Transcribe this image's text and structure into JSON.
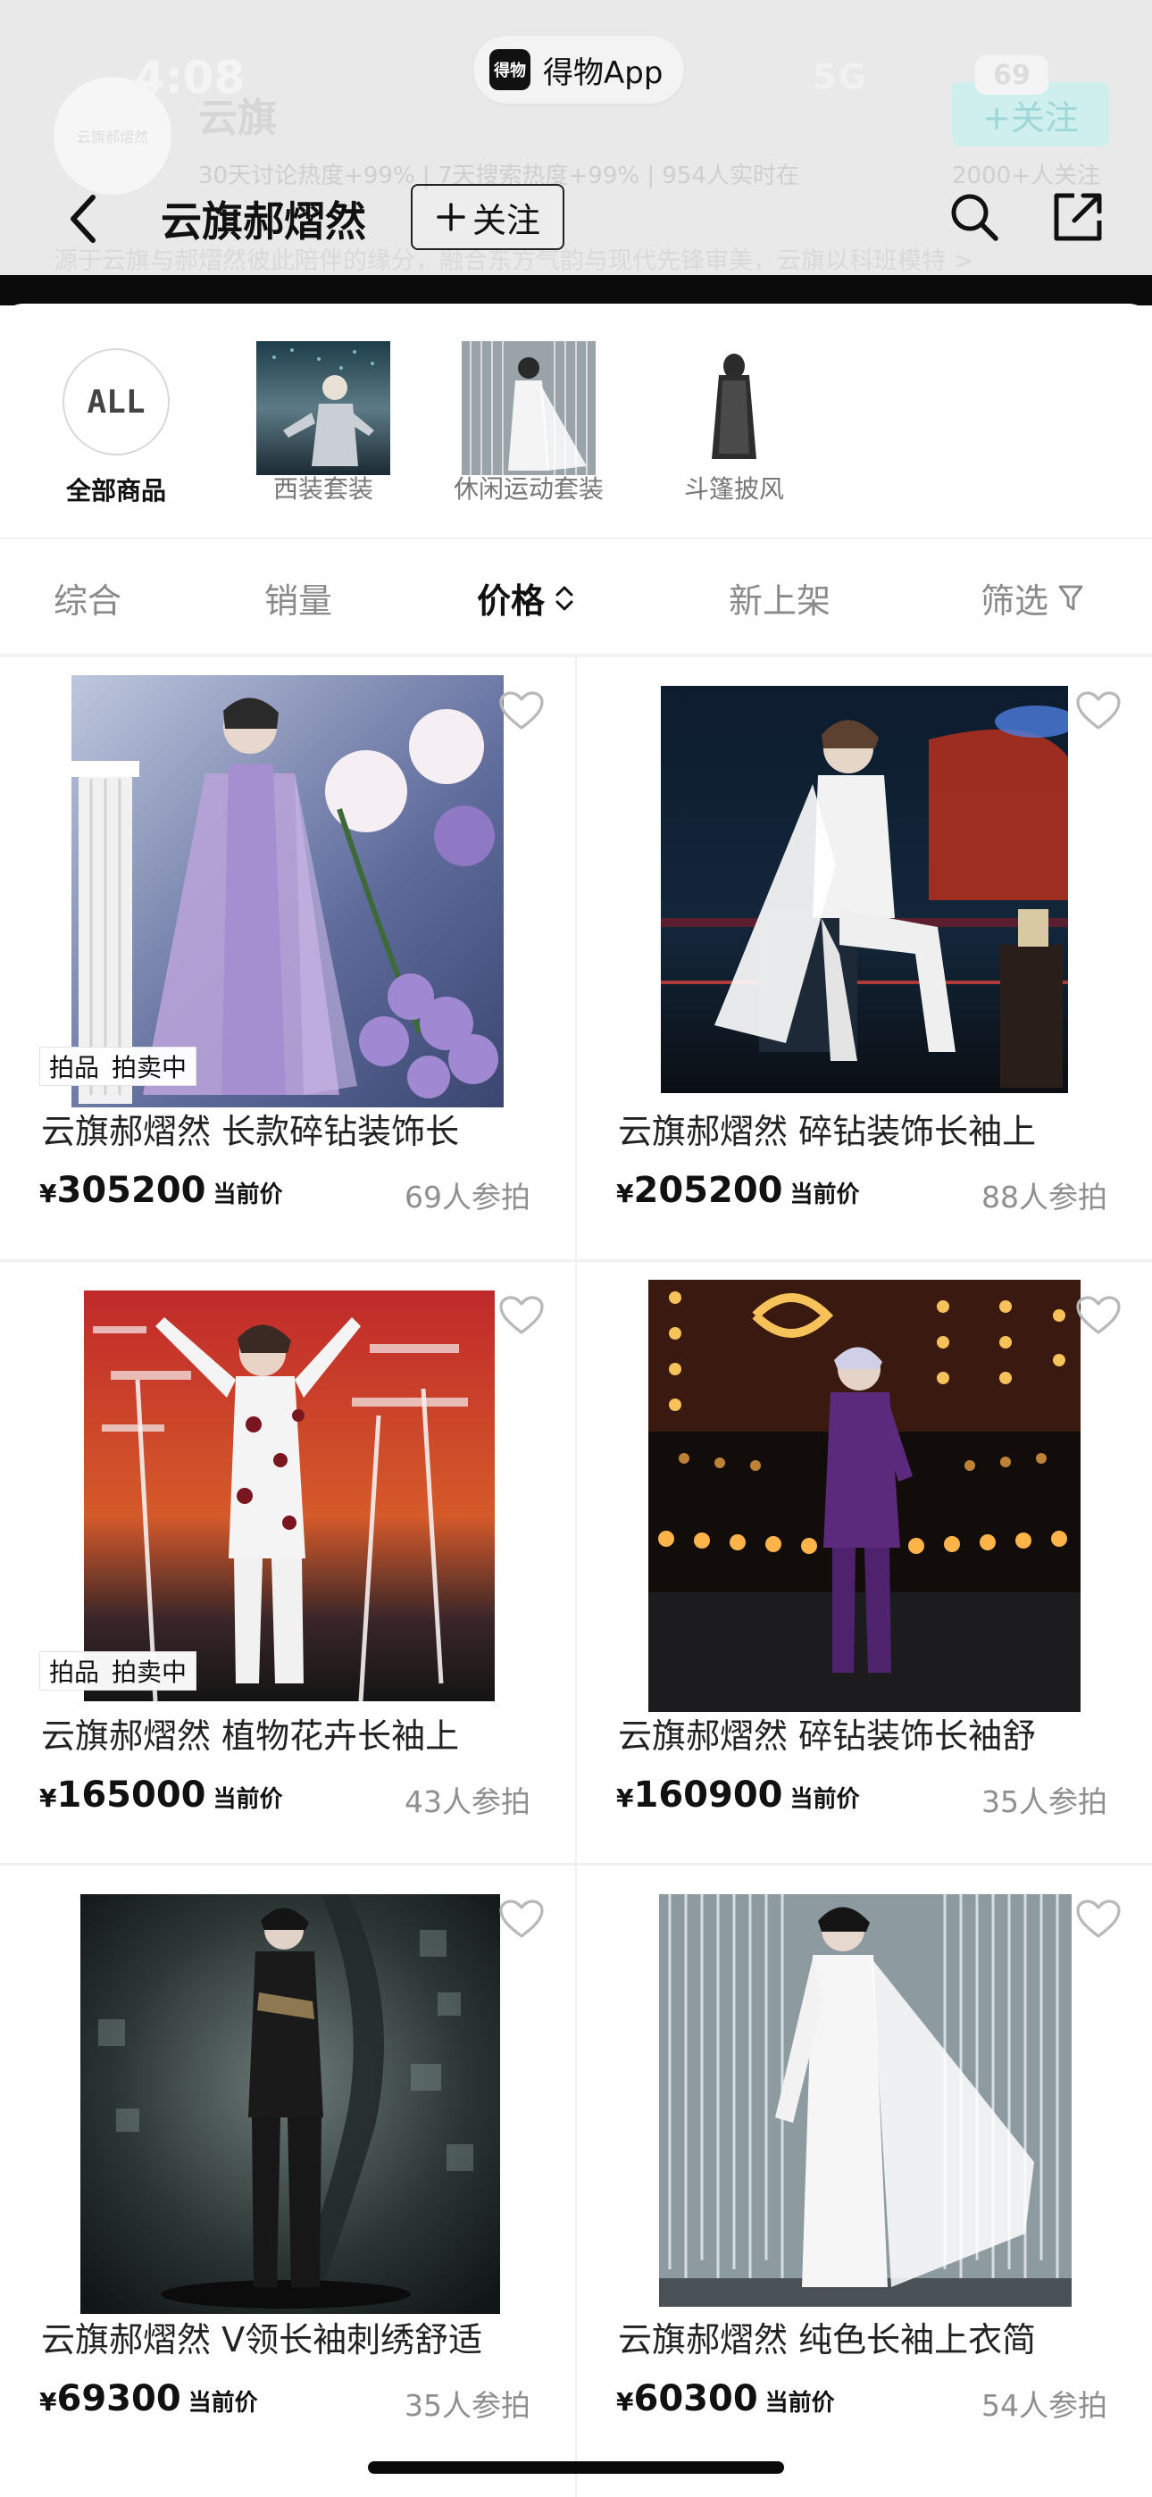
{
  "status_bar": {
    "time": "4:08",
    "app_name": "得物App",
    "app_logo": "得物",
    "signal": "5G",
    "battery": "69"
  },
  "banner": {
    "avatar_text": "云旗郝熠然",
    "title": "云旗",
    "follow": "+关注",
    "stats": "30天讨论热度+99%  |  7天搜索热度+99%  |  954人实时在",
    "followers": "2000+人关注",
    "description": "源于云旗与郝熠然彼此陪伴的缘分，融合东方气韵与现代先锋审美，云旗以科班模特 >"
  },
  "nav": {
    "brand_name": "云旗郝熠然",
    "follow_label": "关注"
  },
  "categories": [
    {
      "label": "全部商品",
      "badge": "ALL"
    },
    {
      "label": "西装套装"
    },
    {
      "label": "休闲运动套装"
    },
    {
      "label": "斗篷披风"
    }
  ],
  "sort": {
    "comprehensive": "综合",
    "sales": "销量",
    "price": "价格",
    "new": "新上架",
    "filter": "筛选"
  },
  "products": [
    {
      "title": "云旗郝熠然 长款碎钻装饰长",
      "price": "305200",
      "price_label": "当前价",
      "bidders": "69人参拍",
      "tag1": "拍品",
      "tag2": "拍卖中",
      "has_tag": true
    },
    {
      "title": "云旗郝熠然 碎钻装饰长袖上",
      "price": "205200",
      "price_label": "当前价",
      "bidders": "88人参拍",
      "has_tag": false
    },
    {
      "title": "云旗郝熠然 植物花卉长袖上",
      "price": "165000",
      "price_label": "当前价",
      "bidders": "43人参拍",
      "tag1": "拍品",
      "tag2": "拍卖中",
      "has_tag": true
    },
    {
      "title": "云旗郝熠然 碎钻装饰长袖舒",
      "price": "160900",
      "price_label": "当前价",
      "bidders": "35人参拍",
      "has_tag": false
    },
    {
      "title": "云旗郝熠然 V领长袖刺绣舒适",
      "price": "69300",
      "price_label": "当前价",
      "bidders": "35人参拍",
      "has_tag": false
    },
    {
      "title": "云旗郝熠然 纯色长袖上衣简",
      "price": "60300",
      "price_label": "当前价",
      "bidders": "54人参拍",
      "has_tag": false
    }
  ],
  "currency_symbol": "¥",
  "colors": {
    "text": "#111111",
    "muted": "#8f8f8f",
    "divider": "#f0f0f0",
    "accent_follow": "#cfeeee"
  }
}
